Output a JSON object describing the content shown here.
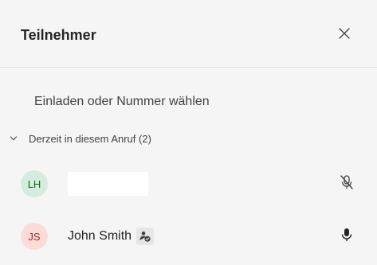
{
  "panel": {
    "title": "Teilnehmer",
    "close_icon": "close-icon"
  },
  "invite": {
    "placeholder": "Einladen oder Nummer wählen"
  },
  "section": {
    "label": "Derzeit in diesem Anruf (2)",
    "chevron_icon": "chevron-down-icon"
  },
  "participants": [
    {
      "initials": "LH",
      "name": "",
      "mic_icon": "mic-off-icon",
      "avatar_bg": "#d5ecdf",
      "avatar_fg": "#0e700e"
    },
    {
      "initials": "JS",
      "name": "John Smith",
      "badge_icon": "organizer-badge-icon",
      "mic_icon": "mic-icon",
      "avatar_bg": "#fbdcd7",
      "avatar_fg": "#a4262c"
    }
  ]
}
